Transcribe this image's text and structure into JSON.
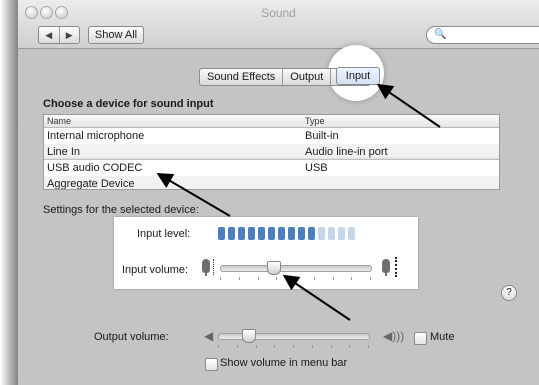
{
  "window": {
    "title": "Sound"
  },
  "toolbar": {
    "back_label": "◀",
    "forward_label": "▶",
    "show_all_label": "Show All",
    "search_placeholder": ""
  },
  "tabs": [
    {
      "label": "Sound Effects"
    },
    {
      "label": "Output"
    },
    {
      "label": "Input"
    }
  ],
  "input_pane": {
    "heading": "Choose a device for sound input",
    "columns": [
      "Name",
      "Type"
    ],
    "devices": [
      {
        "name": "Internal microphone",
        "type": "Built-in"
      },
      {
        "name": "Line In",
        "type": "Audio line-in port"
      },
      {
        "name": "USB audio CODEC",
        "type": "USB"
      },
      {
        "name": "Aggregate Device",
        "type": ""
      }
    ],
    "selected_index": 2,
    "settings_label": "Settings for the selected device:",
    "input_level_label": "Input level:",
    "input_level": {
      "lit": 10,
      "total": 14
    },
    "input_volume_label": "Input volume:",
    "input_volume_fraction": 0.35,
    "help_label": "?"
  },
  "output": {
    "volume_label": "Output volume:",
    "volume_fraction": 0.2,
    "mute_label": "Mute",
    "mute_checked": false,
    "show_volume_label": "Show volume in menu bar",
    "show_volume_checked": false
  },
  "colors": {
    "led_on": "#4d7fbf",
    "led_off": "#c6d6ea",
    "highlight_ring": "#ffffff",
    "arrow": "#000000"
  }
}
